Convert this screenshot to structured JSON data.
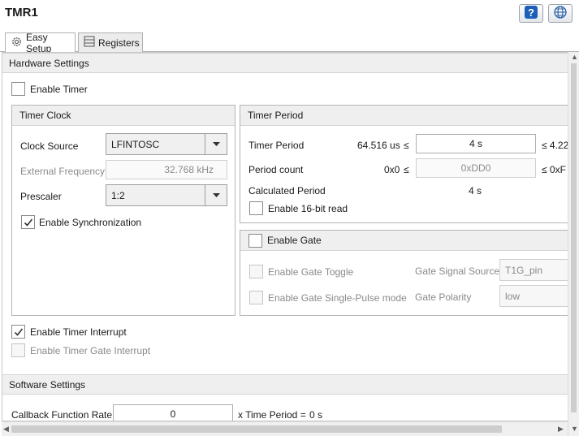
{
  "header": {
    "title": "TMR1"
  },
  "icons": {
    "help": "help-icon",
    "globe": "globe-icon",
    "gear": "gear-icon",
    "registers": "registers-icon"
  },
  "tabs": [
    {
      "label": "Easy Setup",
      "active": true
    },
    {
      "label": "Registers",
      "active": false
    }
  ],
  "hardware": {
    "title": "Hardware Settings",
    "enable_timer": {
      "label": "Enable Timer",
      "checked": false
    },
    "timer_clock": {
      "title": "Timer Clock",
      "clock_source": {
        "label": "Clock Source",
        "value": "LFINTOSC"
      },
      "external_frequency": {
        "label": "External Frequency",
        "value": "32.768 kHz"
      },
      "prescaler": {
        "label": "Prescaler",
        "value": "1:2"
      },
      "enable_sync": {
        "label": "Enable Synchronization",
        "checked": true
      }
    },
    "timer_period": {
      "title": "Timer Period",
      "period": {
        "label": "Timer Period",
        "min": "64.516 us",
        "le": "≤",
        "value": "4 s",
        "max": "≤  4.22"
      },
      "count": {
        "label": "Period count",
        "min": "0x0",
        "le": "≤",
        "value": "0xDD0",
        "max": "≤  0xF"
      },
      "calculated": {
        "label": "Calculated Period",
        "value": "4 s"
      },
      "read16": {
        "label": "Enable 16-bit read",
        "checked": false
      }
    },
    "gate": {
      "title": "Enable Gate",
      "checked": false,
      "toggle": {
        "label": "Enable Gate Toggle",
        "checked": false
      },
      "single_pulse": {
        "label": "Enable Gate Single-Pulse mode",
        "checked": false
      },
      "signal_source": {
        "label": "Gate Signal Source",
        "value": "T1G_pin"
      },
      "polarity": {
        "label": "Gate Polarity",
        "value": "low"
      }
    },
    "timer_interrupt": {
      "label": "Enable Timer Interrupt",
      "checked": true
    },
    "gate_interrupt": {
      "label": "Enable Timer Gate Interrupt",
      "checked": false
    }
  },
  "software": {
    "title": "Software Settings",
    "callback": {
      "label": "Callback Function Rate",
      "value": "0",
      "suffix": "x Time Period = ",
      "result": "0 s"
    }
  },
  "colors": {
    "section_bg": "#efefef",
    "border": "#b5b5b5",
    "help_blue": "#1c5fb8",
    "disabled_text": "#8a8a8a"
  }
}
